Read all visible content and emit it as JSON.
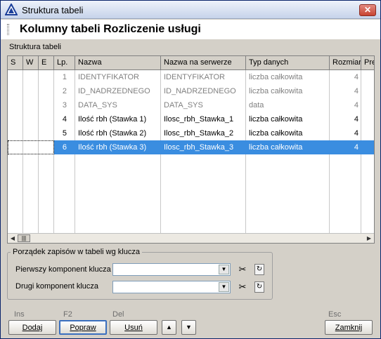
{
  "window": {
    "title": "Struktura tabeli",
    "close_label": "✕"
  },
  "header": {
    "title": "Kolumny tabeli Rozliczenie usługi"
  },
  "structure_section": {
    "label": "Struktura tabeli"
  },
  "grid": {
    "columns": [
      "S",
      "W",
      "E",
      "Lp.",
      "Nazwa",
      "Nazwa na serwerze",
      "Typ danych",
      "Rozmiar",
      "Pre"
    ],
    "rows": [
      {
        "lp": "1",
        "name": "IDENTYFIKATOR",
        "server_name": "IDENTYFIKATOR",
        "type": "liczba całkowita",
        "size": "4",
        "state": "dim"
      },
      {
        "lp": "2",
        "name": "ID_NADRZEDNEGO",
        "server_name": "ID_NADRZEDNEGO",
        "type": "liczba całkowita",
        "size": "4",
        "state": "dim"
      },
      {
        "lp": "3",
        "name": "DATA_SYS",
        "server_name": "DATA_SYS",
        "type": "data",
        "size": "4",
        "state": "dim"
      },
      {
        "lp": "4",
        "name": "Ilość rbh (Stawka 1)",
        "server_name": "Ilosc_rbh_Stawka_1",
        "type": "liczba całkowita",
        "size": "4",
        "state": "normal"
      },
      {
        "lp": "5",
        "name": "Ilość rbh (Stawka 2)",
        "server_name": "Ilosc_rbh_Stawka_2",
        "type": "liczba całkowita",
        "size": "4",
        "state": "normal"
      },
      {
        "lp": "6",
        "name": "Ilość rbh (Stawka 3)",
        "server_name": "Ilosc_rbh_Stawka_3",
        "type": "liczba całkowita",
        "size": "4",
        "state": "selected"
      }
    ]
  },
  "sort_group": {
    "title": "Porządek zapisów w tabeli wg klucza",
    "first_key_label": "Pierwszy komponent klucza",
    "first_key_value": "",
    "second_key_label": "Drugi komponent klucza",
    "second_key_value": ""
  },
  "hints": {
    "add": "Ins",
    "edit": "F2",
    "delete": "Del",
    "close": "Esc"
  },
  "buttons": {
    "add": "Dodaj",
    "edit": "Popraw",
    "delete": "Usuń",
    "close": "Zamknij"
  },
  "icons": {
    "app": "triangle-icon",
    "clear": "scissors-icon",
    "refresh": "refresh-icon",
    "move_up": "arrow-up-icon",
    "move_down": "arrow-down-icon"
  },
  "colors": {
    "selection": "#3a8de0",
    "dim_text": "#808080",
    "window_bg": "#d4d0c8"
  }
}
